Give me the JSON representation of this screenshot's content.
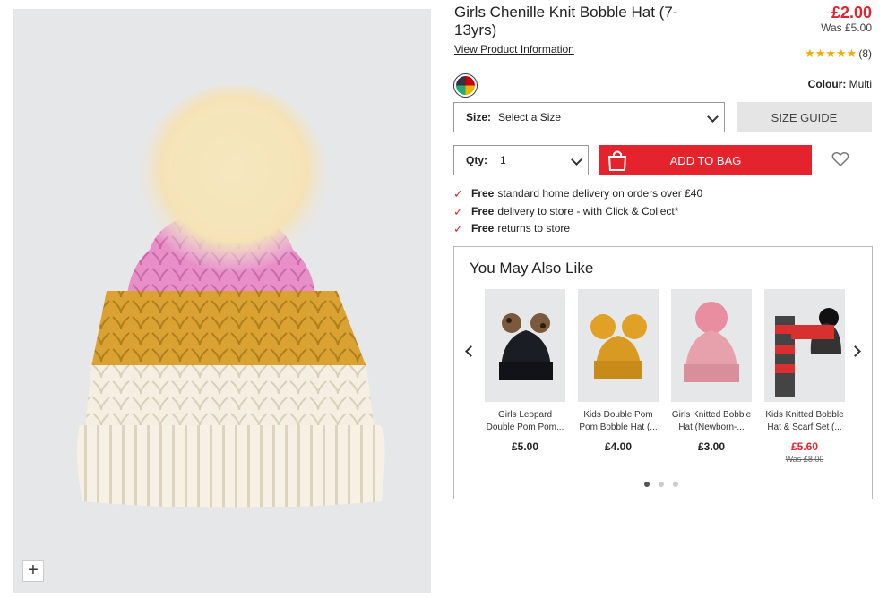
{
  "product": {
    "title": "Girls Chenille Knit Bobble Hat (7-13yrs)",
    "price": "£2.00",
    "was_price": "Was £5.00",
    "view_info_label": "View Product Information",
    "review_count": "(8)",
    "rating": 5,
    "colour_label": "Colour:",
    "colour_value": "Multi"
  },
  "size": {
    "label": "Size:",
    "value": "Select a Size",
    "guide_label": "SIZE GUIDE"
  },
  "quantity": {
    "label": "Qty:",
    "value": "1"
  },
  "actions": {
    "add_to_bag": "ADD TO BAG"
  },
  "delivery": [
    {
      "bold": "Free",
      "text": "standard home delivery on orders over £40"
    },
    {
      "bold": "Free",
      "text": "delivery to store - with Click & Collect*"
    },
    {
      "bold": "Free",
      "text": "returns to store"
    }
  ],
  "recommendations": {
    "title": "You May Also Like",
    "items": [
      {
        "name": "Girls Leopard Double Pom Pom...",
        "price": "£5.00",
        "was": ""
      },
      {
        "name": "Kids Double Pom Pom Bobble Hat (...",
        "price": "£4.00",
        "was": ""
      },
      {
        "name": "Girls Knitted Bobble Hat (Newborn-...",
        "price": "£3.00",
        "was": ""
      },
      {
        "name": "Kids Knitted Bobble Hat & Scarf Set (...",
        "price": "£5.60",
        "was": "Was £8.00"
      }
    ]
  },
  "image_controls": {
    "zoom": "+"
  },
  "colors": {
    "accent_red": "#e4232d",
    "star": "#f2a900"
  }
}
